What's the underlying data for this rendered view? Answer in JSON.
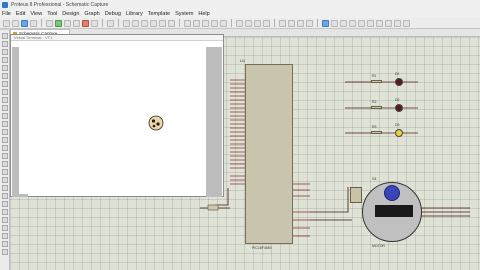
{
  "window": {
    "title": "Proteus 8 Professional - Schematic Capture"
  },
  "menu": {
    "items": [
      "File",
      "Edit",
      "View",
      "Tool",
      "Design",
      "Graph",
      "Debug",
      "Library",
      "Template",
      "System",
      "Help"
    ]
  },
  "tab": {
    "label": "Schematic Capture"
  },
  "virtual_terminal": {
    "title": "Virtual Terminal - VT1"
  },
  "schematic": {
    "mcu_label": "U1",
    "mcu_sub": "PIC18F4550",
    "servo_label": "S1",
    "servo_sub": "MOTOR",
    "led_labels": [
      "D1",
      "D2",
      "D3"
    ],
    "resistor_labels": [
      "R1",
      "R2",
      "R3"
    ]
  }
}
